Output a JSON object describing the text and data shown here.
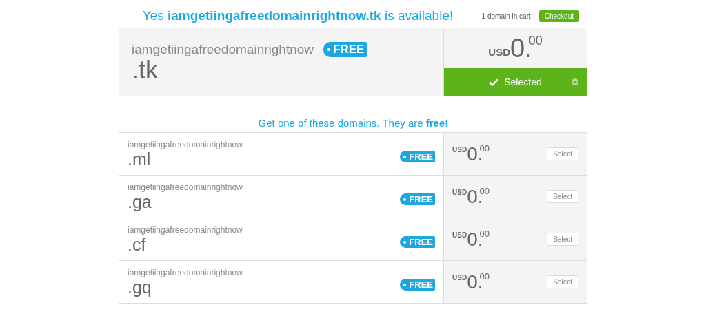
{
  "headline": "Yes **iamgetiingafreedomainrightnow.tk** is available!",
  "cart": {
    "count_text": "1 domain in cart",
    "checkout": "Checkout"
  },
  "main": {
    "name": "iamgetiingafreedomainrightnow",
    "tld": ".tk",
    "badge": "FREE",
    "price": {
      "currency": "USD",
      "whole": "0.",
      "cents": "00"
    },
    "selected": true,
    "button": "Selected"
  },
  "subheadline": "Get one of these domains. They are **free**!",
  "options": [
    {
      "name": "iamgetiingafreedomainrightnow",
      "tld": ".ml",
      "badge": "FREE",
      "price": {
        "currency": "USD",
        "whole": "0.",
        "cents": "00"
      },
      "selected": false,
      "button": "Select"
    },
    {
      "name": "iamgetiingafreedomainrightnow",
      "tld": ".ga",
      "badge": "FREE",
      "price": {
        "currency": "USD",
        "whole": "0.",
        "cents": "00"
      },
      "selected": false,
      "button": "Select"
    },
    {
      "name": "iamgetiingafreedomainrightnow",
      "tld": ".cf",
      "badge": "FREE",
      "price": {
        "currency": "USD",
        "whole": "0.",
        "cents": "00"
      },
      "selected": false,
      "button": "Select"
    },
    {
      "name": "iamgetiingafreedomainrightnow",
      "tld": ".gq",
      "badge": "FREE",
      "price": {
        "currency": "USD",
        "whole": "0.",
        "cents": "00"
      },
      "selected": false,
      "button": "Select"
    }
  ]
}
